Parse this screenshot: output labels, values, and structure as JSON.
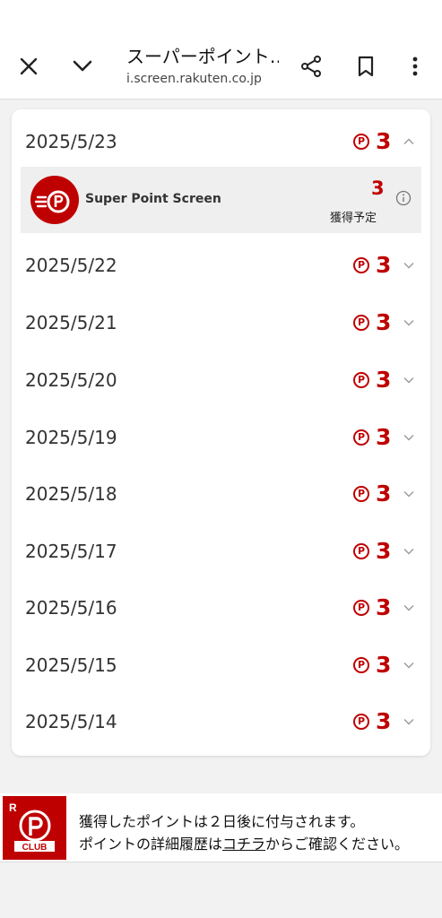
{
  "browser": {
    "title": "スーパーポイント…",
    "url": "i.screen.rakuten.co.jp",
    "icons": [
      "close-icon",
      "chevron-down-icon",
      "share-icon",
      "bookmark-icon",
      "more-vert-icon"
    ]
  },
  "colors": {
    "accent": "#bf0000",
    "card_bg": "#ffffff",
    "page_bg": "#f2f2f2",
    "detail_bg": "#efefef"
  },
  "point_symbol": "P",
  "history": [
    {
      "date": "2025/5/23",
      "points": "3",
      "expanded": true
    },
    {
      "date": "2025/5/22",
      "points": "3",
      "expanded": false
    },
    {
      "date": "2025/5/21",
      "points": "3",
      "expanded": false
    },
    {
      "date": "2025/5/20",
      "points": "3",
      "expanded": false
    },
    {
      "date": "2025/5/19",
      "points": "3",
      "expanded": false
    },
    {
      "date": "2025/5/18",
      "points": "3",
      "expanded": false
    },
    {
      "date": "2025/5/17",
      "points": "3",
      "expanded": false
    },
    {
      "date": "2025/5/16",
      "points": "3",
      "expanded": false
    },
    {
      "date": "2025/5/15",
      "points": "3",
      "expanded": false
    },
    {
      "date": "2025/5/14",
      "points": "3",
      "expanded": false
    }
  ],
  "detail": {
    "app_name": "Super Point Screen",
    "points": "3",
    "status": "獲得予定"
  },
  "banner": {
    "line1": "獲得したポイントは２日後に付与されます。",
    "line2_before": "ポイントの詳細履歴は",
    "line2_link": "コチラ",
    "line2_after": "からご確認ください。"
  }
}
